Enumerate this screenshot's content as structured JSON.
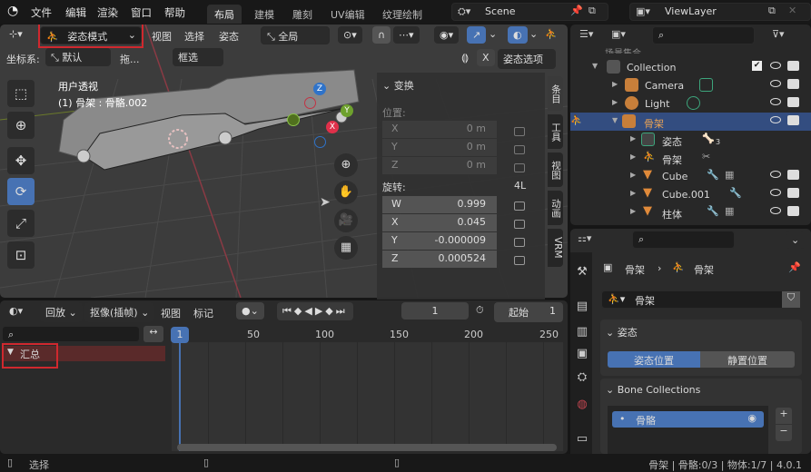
{
  "topbar": {
    "menus": [
      "文件",
      "编辑",
      "渲染",
      "窗口",
      "帮助"
    ],
    "workspaces": [
      "布局",
      "建模",
      "雕刻",
      "UV编辑",
      "纹理绘制"
    ],
    "active_workspace": "布局",
    "scene": "Scene",
    "view_layer": "ViewLayer"
  },
  "viewport": {
    "header": {
      "mode": "姿态模式",
      "menu_view": "视图",
      "menu_select": "选择",
      "menu_pose": "姿态",
      "transform_orientation": "全局",
      "coord_label": "坐标系:",
      "coord_value": "默认",
      "drag_label": "拖...",
      "select_mode": "框选",
      "mirror_x": "X",
      "pose_options": "姿态选项"
    },
    "overlay": {
      "view_name": "用户透视",
      "active": "(1) 骨架 : 骨骼.002"
    },
    "gizmo": {
      "z": "Z",
      "y": "Y",
      "x": "X"
    }
  },
  "npanel": {
    "title": "变换",
    "location_label": "位置:",
    "location": [
      {
        "axis": "X",
        "value": "0 m"
      },
      {
        "axis": "Y",
        "value": "0 m"
      },
      {
        "axis": "Z",
        "value": "0 m"
      }
    ],
    "rotation_label": "旋转:",
    "rotation_mode": "4L",
    "rotation": [
      {
        "axis": "W",
        "value": "0.999"
      },
      {
        "axis": "X",
        "value": "0.045"
      },
      {
        "axis": "Y",
        "value": "-0.000009"
      },
      {
        "axis": "Z",
        "value": "0.000524"
      }
    ],
    "tabs": [
      "条目",
      "工具",
      "视图",
      "动画",
      "VRM"
    ]
  },
  "outliner": {
    "partial_title": "场景集合",
    "rows": [
      {
        "name": "Collection"
      },
      {
        "name": "Camera"
      },
      {
        "name": "Light"
      },
      {
        "name": "骨架"
      },
      {
        "name": "姿态",
        "badge": "3"
      },
      {
        "name": "骨架"
      },
      {
        "name": "Cube"
      },
      {
        "name": "Cube.001"
      },
      {
        "name": "柱体"
      }
    ]
  },
  "properties": {
    "breadcrumb_object": "骨架",
    "breadcrumb_data": "骨架",
    "data_name": "骨架",
    "pose_section": "姿态",
    "pose_position": "姿态位置",
    "rest_position": "静置位置",
    "bone_collections_section": "Bone Collections",
    "bone_collection_item": "骨骼",
    "add": "+",
    "remove": "−"
  },
  "timeline": {
    "menu_playback": "回放",
    "menu_keying": "抠像(插帧)",
    "menu_view": "视图",
    "menu_marker": "标记",
    "current_frame": "1",
    "start_label": "起始",
    "start_value": "1",
    "summary": "汇总",
    "ruler": [
      "50",
      "100",
      "150",
      "200",
      "250"
    ],
    "playhead": "1"
  },
  "statusbar": {
    "select": "选择",
    "info": "骨架 | 骨骼:0/3 | 物体:1/7 | 4.0.1"
  },
  "colors": {
    "accent": "#4772b3",
    "selected_row": "#334d80",
    "highlight": "#d0282e"
  }
}
